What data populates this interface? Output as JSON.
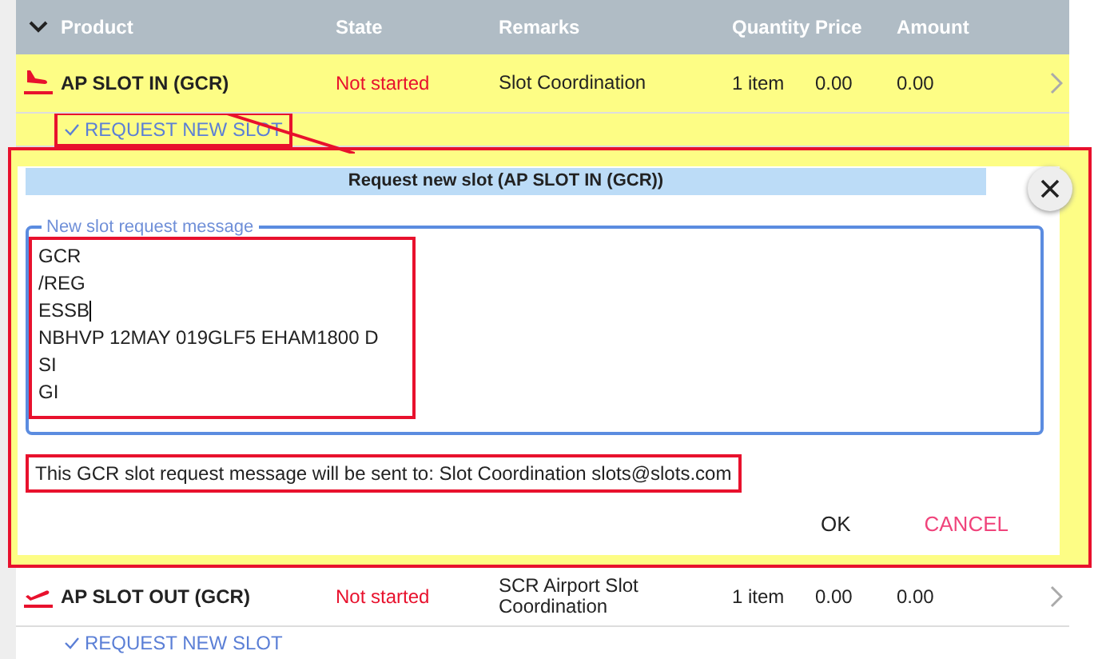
{
  "table": {
    "expanded": true,
    "columns": [
      "Product",
      "State",
      "Remarks",
      "Quantity",
      "Price",
      "Amount"
    ],
    "rows": [
      {
        "kind": "arrival",
        "product": "AP SLOT IN (GCR)",
        "state": "Not started",
        "remarks": "Slot Coordination",
        "quantity": "1 item",
        "price": "0.00",
        "amount": "0.00",
        "selected": true,
        "action": {
          "label": "REQUEST NEW SLOT",
          "highlighted": true
        },
        "dialog": {
          "title": "Request new slot (AP SLOT IN (GCR))",
          "highlighted": true,
          "field": {
            "label": "New slot request message",
            "lines": [
              "GCR",
              "/REG",
              "ESSB",
              "NBHVP 12MAY 019GLF5 EHAM1800 D",
              "SI",
              "GI"
            ],
            "highlighted": true
          },
          "notice": {
            "text": "This GCR slot request message will be sent to: Slot Coordination slots@slots.com",
            "highlighted": true
          },
          "buttons": [
            {
              "label": "OK",
              "kind": "primary"
            },
            {
              "label": "CANCEL",
              "kind": "cancel"
            }
          ]
        }
      },
      {
        "kind": "departure",
        "product": "AP SLOT OUT (GCR)",
        "state": "Not started",
        "remarks": "SCR Airport Slot Coordination",
        "quantity": "1 item",
        "price": "0.00",
        "amount": "0.00",
        "selected": false,
        "action": {
          "label": "REQUEST NEW SLOT",
          "highlighted": false
        }
      }
    ]
  }
}
